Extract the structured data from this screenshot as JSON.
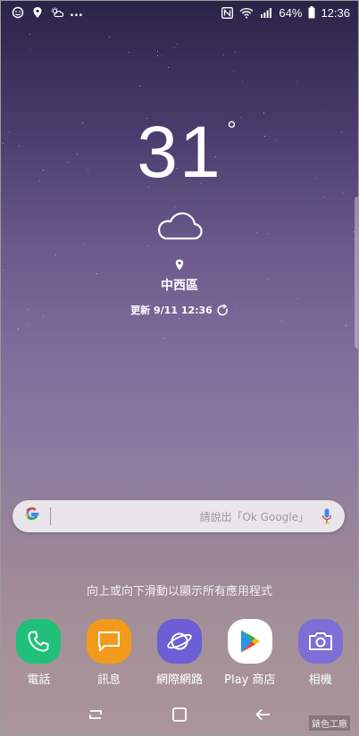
{
  "status_bar": {
    "battery": "64%",
    "time": "12:36",
    "overflow": "..."
  },
  "weather": {
    "temperature": "31",
    "degree_symbol": "°",
    "city": "中西區",
    "updated": "更新 9/11 12:36"
  },
  "search": {
    "logo": "G",
    "placeholder": "請說出「Ok Google」"
  },
  "swipe_hint": "向上或向下滑動以顯示所有應用程式",
  "dock": {
    "apps": [
      {
        "label": "電話",
        "icon": "phone-icon",
        "color": "#1fc07a"
      },
      {
        "label": "訊息",
        "icon": "message-icon",
        "color": "#f39a1c"
      },
      {
        "label": "網際網路",
        "icon": "internet-icon",
        "color": "#6c5ed4"
      },
      {
        "label": "Play 商店",
        "icon": "play-store-icon",
        "color": "#ffffff"
      },
      {
        "label": "相機",
        "icon": "camera-icon",
        "color": "#7e6fd6"
      }
    ]
  },
  "watermark": "錶色工廠"
}
